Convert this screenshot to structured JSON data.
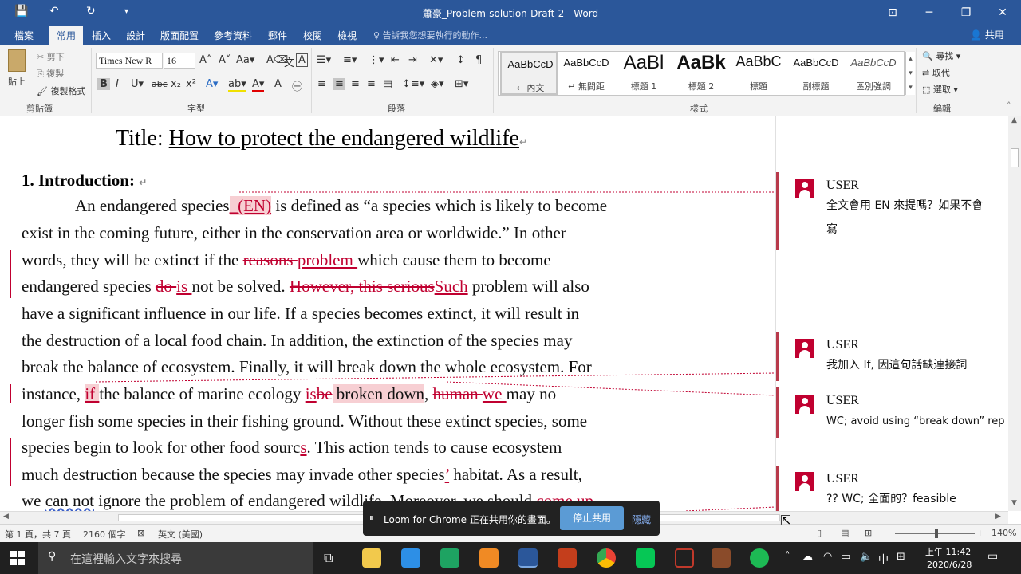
{
  "window": {
    "title": "蕭豪_Problem-solution-Draft-2 - Word"
  },
  "tabs": [
    "檔案",
    "常用",
    "插入",
    "設計",
    "版面配置",
    "參考資料",
    "郵件",
    "校閱",
    "檢視"
  ],
  "tell_me": "告訴我您想要執行的動作...",
  "share_label": "共用",
  "ribbon": {
    "clipboard": {
      "paste": "貼上",
      "cut": "剪下",
      "copy": "複製",
      "format_painter": "複製格式",
      "group": "剪貼簿"
    },
    "font": {
      "name": "Times New R",
      "size": "16",
      "group": "字型"
    },
    "paragraph": {
      "group": "段落"
    },
    "styles": {
      "items": [
        {
          "preview": "AaBbCcD",
          "name": "↵ 內文"
        },
        {
          "preview": "AaBbCcD",
          "name": "↵ 無間距"
        },
        {
          "preview": "AaBl",
          "name": "標題 1"
        },
        {
          "preview": "AaBk",
          "name": "標題 2"
        },
        {
          "preview": "AaBbC",
          "name": "標題"
        },
        {
          "preview": "AaBbCcD",
          "name": "副標題"
        },
        {
          "preview": "AaBbCcD",
          "name": "區別強調"
        }
      ],
      "group": "樣式"
    },
    "editing": {
      "find": "尋找",
      "replace": "取代",
      "select": "選取",
      "group": "編輯"
    }
  },
  "document": {
    "title_prefix": "Title: ",
    "title_text": "How to protect the endangered wildlife",
    "heading": "1. Introduction:",
    "para": {
      "l1a": "An endangered species",
      "l1ins": "_(EN)",
      "l1b": " is defined as “a species which is likely to become",
      "l2": "exist in the coming future, either in the conservation area or worldwide.” In other",
      "l3a": "words, they will be extinct if the ",
      "l3del": "reasons ",
      "l3ins": "problem ",
      "l3b": "which cause them to become",
      "l4a": "endangered species ",
      "l4del": "do ",
      "l4ins": "is ",
      "l4b": "not be solved. ",
      "l4del2": "However, this serious",
      "l4ins2": "Such",
      "l4c": " problem will also",
      "l5": "have a significant influence in our life. If a species becomes extinct, it will result in",
      "l6": "the destruction of a local food chain. In addition, the extinction of the species may",
      "l7": "break the balance of ecosystem. Finally, it will break down the whole ecosystem. For",
      "l8a": "instance, ",
      "l8ins": "if ",
      "l8b": "the balance of marine ecology ",
      "l8ins2": "is",
      "l8del": "be",
      "l8hl": " broken down",
      "l8c": ", ",
      "l8del2": "human ",
      "l8ins3": "we ",
      "l8d": "may no",
      "l9": "longer fish some species in their fishing ground. Without these extinct species, some",
      "l10a": "species begin to look for other food sourc",
      "l10ins": "s",
      "l10b": ". This action tends to cause ecosystem",
      "l11a": "much destruction because the species may invade other species",
      "l11ins": "’",
      "l11b": " habitat. As a result,",
      "l12a": "we ",
      "l12w": "can not",
      "l12b": " ignore the problem of endangered wildlife. Moreover, we should ",
      "l12ins": "come up"
    }
  },
  "comments": [
    {
      "author": "USER",
      "text": "全文會用 EN 來提嗎？如果不會",
      "text2": "寫"
    },
    {
      "author": "USER",
      "text": "我加入 If,  因這句話缺連接詞"
    },
    {
      "author": "USER",
      "text": "WC; avoid using “break down” rep"
    },
    {
      "author": "USER",
      "text": "?? WC;  全面的？feasible"
    }
  ],
  "status": {
    "page": "第 1 頁，共 7 頁",
    "words": "2160 個字",
    "lang": "英文 (美國)",
    "zoom": "140%"
  },
  "loom": {
    "text": "Loom for Chrome 正在共用你的畫面。",
    "stop": "停止共用",
    "hide": "隱藏"
  },
  "taskbar": {
    "search_placeholder": "在這裡輸入文字來搜尋",
    "ime": "中",
    "time": "上午 11:42",
    "date": "2020/6/28"
  }
}
